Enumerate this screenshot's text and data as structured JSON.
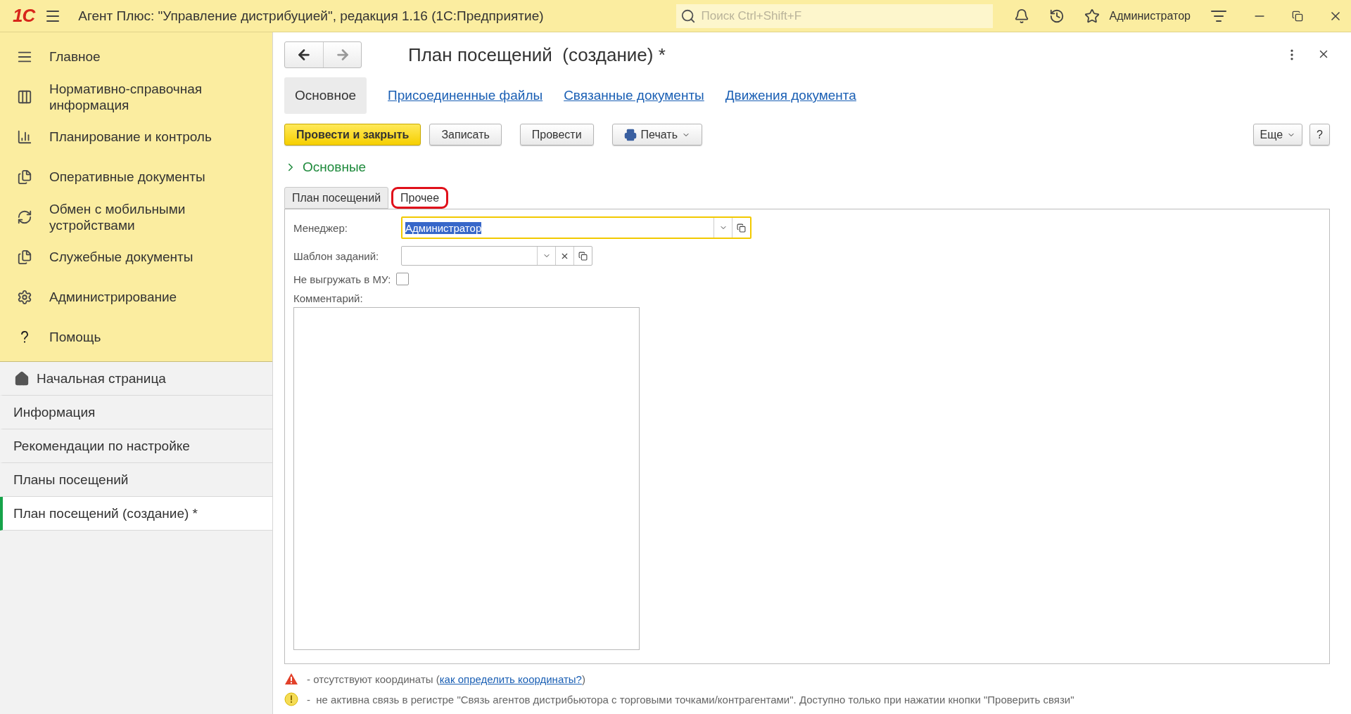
{
  "app_bar": {
    "logo": "1С",
    "title": "Агент Плюс: \"Управление дистрибуцией\", редакция 1.16  (1С:Предприятие)",
    "search": {
      "placeholder": "Поиск Ctrl+Shift+F"
    },
    "user": "Администратор"
  },
  "sidebar": {
    "sections": [
      {
        "label": "Главное"
      },
      {
        "label": "Нормативно-справочная информация"
      },
      {
        "label": "Планирование и контроль"
      },
      {
        "label": "Оперативные документы"
      },
      {
        "label": "Обмен с мобильными устройствами"
      },
      {
        "label": "Служебные документы"
      },
      {
        "label": "Администрирование"
      },
      {
        "label": "Помощь"
      }
    ],
    "open_windows": [
      {
        "label": "Начальная страница",
        "kind": "home",
        "selected": false
      },
      {
        "label": "Информация",
        "kind": "page",
        "selected": false
      },
      {
        "label": "Рекомендации по настройке",
        "kind": "page",
        "selected": false
      },
      {
        "label": "Планы посещений",
        "kind": "page",
        "selected": false
      },
      {
        "label": "План посещений  (создание) *",
        "kind": "page",
        "selected": true
      }
    ]
  },
  "form": {
    "title": "План посещений  (создание) *",
    "tabs": [
      {
        "label": "Основное",
        "selected": true
      },
      {
        "label": "Присоединенные файлы",
        "selected": false
      },
      {
        "label": "Связанные документы",
        "selected": false
      },
      {
        "label": "Движения документа",
        "selected": false
      }
    ],
    "buttons": [
      {
        "label": "Провести и закрыть",
        "kind": "primary"
      },
      {
        "label": "Записать",
        "kind": "plain"
      },
      {
        "label": "Провести",
        "kind": "plain"
      },
      {
        "label": "Печать",
        "kind": "print"
      }
    ],
    "right_buttons": [
      {
        "label": "Еще",
        "kind": "menu"
      },
      {
        "label": "?",
        "kind": "plain"
      }
    ],
    "group": {
      "label": "Основные",
      "expanded": false
    },
    "subtabs": [
      {
        "label": "План посещений",
        "selected": false,
        "highlighted": false
      },
      {
        "label": "Прочее",
        "selected": true,
        "highlighted": true
      }
    ],
    "fields": {
      "manager": {
        "label": "Менеджер:",
        "value": "Администратор",
        "focused": true,
        "text_selected": true
      },
      "template": {
        "label": "Шаблон заданий:",
        "focused": false
      },
      "no_export": {
        "label": "Не выгружать в МУ:",
        "checked": false
      },
      "comment": {
        "label": "Комментарий:"
      }
    },
    "notes": [
      {
        "kind": "warning",
        "text": "- отсутствуют координаты (",
        "link": "как определить координаты?",
        "after": ")"
      },
      {
        "kind": "info",
        "text": "-  не активна связь в регистре \"Связь агентов дистрибьютора с торговыми точками/контрагентами\". Доступно только при нажатии кнопки \"Проверить связи\""
      }
    ]
  }
}
